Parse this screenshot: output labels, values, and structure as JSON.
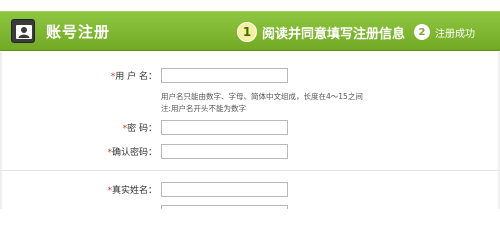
{
  "header": {
    "title": "账号注册",
    "steps": [
      {
        "number": "1",
        "label": "阅读并同意填写注册信息"
      },
      {
        "number": "2",
        "label": "注册成功"
      }
    ],
    "bar_color": "#7fb733"
  },
  "form": {
    "required_mark": "*",
    "username": {
      "label": "用 户 名：",
      "value": ""
    },
    "username_hint_1": "用户名只能由数字、字母、简体中文组成，长度在4～15之间",
    "username_hint_2": "注:用户名开头不能为数字",
    "password": {
      "label": "密 码：",
      "value": ""
    },
    "confirm_password": {
      "label": "确认密码：",
      "value": ""
    },
    "real_name": {
      "label": "真实姓名：",
      "value": ""
    },
    "next_row": {
      "value": ""
    }
  }
}
